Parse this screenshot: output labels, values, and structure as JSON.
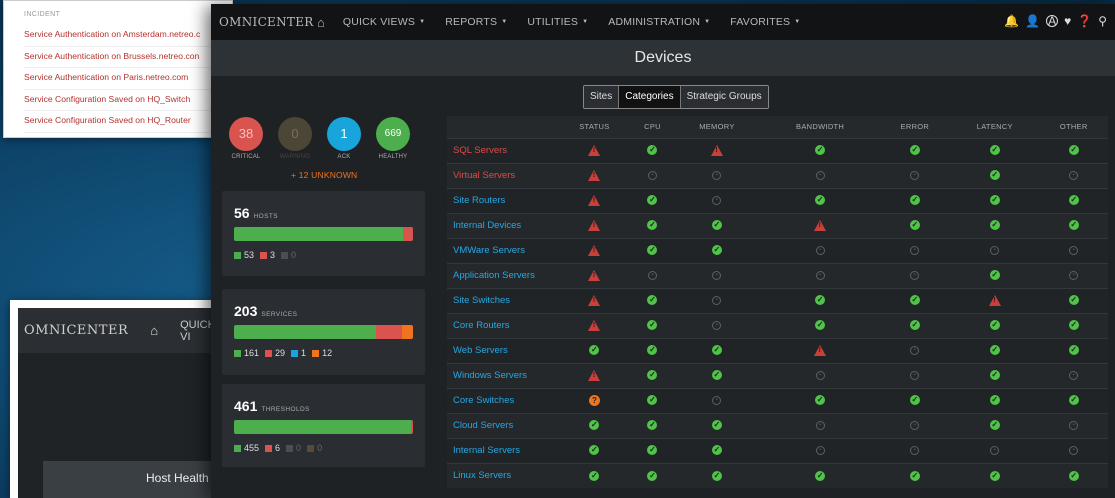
{
  "incident_card": {
    "header": "INCIDENT",
    "rows": [
      "Service Authentication on Amsterdam.netreo.c",
      "Service Authentication on Brussels.netreo.con",
      "Service Authentication on Paris.netreo.com",
      "Service Configuration Saved on HQ_Switch",
      "Service Configuration Saved on HQ_Router"
    ]
  },
  "bg_window": {
    "logo": "OMNICENTER",
    "menu_label": "QUICK VI",
    "host_health": "Host Health"
  },
  "nav": {
    "logo": "OMNICENTER",
    "items": [
      "QUICK VIEWS",
      "REPORTS",
      "UTILITIES",
      "ADMINISTRATION",
      "FAVORITES"
    ]
  },
  "page_title": "Devices",
  "tabs": [
    "Sites",
    "Categories",
    "Strategic Groups"
  ],
  "active_tab": "Categories",
  "stats": [
    {
      "value": "38",
      "label": "CRITICAL"
    },
    {
      "value": "0",
      "label": "WARNING"
    },
    {
      "value": "1",
      "label": "ACK"
    },
    {
      "value": "669",
      "label": "HEALTHY"
    }
  ],
  "unknown_text": "+ 12 UNKNOWN",
  "panels": [
    {
      "count": "56",
      "label": "HOSTS",
      "legend": [
        {
          "value": "53",
          "color": "#4cae4c"
        },
        {
          "value": "3",
          "color": "#d9534f"
        },
        {
          "value": "0",
          "color": "#4a4f54",
          "muted": true
        }
      ],
      "fractions": [
        0.946,
        0.054
      ]
    },
    {
      "count": "203",
      "label": "SERVICES",
      "legend": [
        {
          "value": "161",
          "color": "#4cae4c"
        },
        {
          "value": "29",
          "color": "#d9534f"
        },
        {
          "value": "1",
          "color": "#17a5dc"
        },
        {
          "value": "12",
          "color": "#f0731e"
        }
      ],
      "fractions": [
        0.793,
        0.143,
        0.005,
        0.059
      ]
    },
    {
      "count": "461",
      "label": "THRESHOLDS",
      "legend": [
        {
          "value": "455",
          "color": "#4cae4c"
        },
        {
          "value": "6",
          "color": "#d9534f"
        },
        {
          "value": "0",
          "color": "#4a4f54",
          "muted": true
        },
        {
          "value": "0",
          "color": "#5a4a3a",
          "muted": true
        }
      ],
      "fractions": [
        0.987,
        0.013
      ]
    }
  ],
  "table": {
    "columns": [
      "",
      "STATUS",
      "CPU",
      "MEMORY",
      "BANDWIDTH",
      "ERROR",
      "LATENCY",
      "OTHER"
    ],
    "rows": [
      {
        "name": "SQL Servers",
        "color": "red",
        "cells": [
          "warn",
          "ok",
          "warn",
          "ok",
          "ok",
          "ok",
          "ok"
        ]
      },
      {
        "name": "Virtual Servers",
        "color": "red",
        "cells": [
          "warn",
          "na",
          "na",
          "na",
          "na",
          "ok",
          "na"
        ]
      },
      {
        "name": "Site Routers",
        "color": "blue",
        "cells": [
          "warn",
          "ok",
          "na",
          "ok",
          "ok",
          "ok",
          "ok"
        ]
      },
      {
        "name": "Internal Devices",
        "color": "blue",
        "cells": [
          "warn",
          "ok",
          "ok",
          "warn",
          "ok",
          "ok",
          "ok"
        ]
      },
      {
        "name": "VMWare Servers",
        "color": "blue",
        "cells": [
          "warn",
          "ok",
          "ok",
          "na",
          "na",
          "na",
          "na"
        ]
      },
      {
        "name": "Application Servers",
        "color": "blue",
        "cells": [
          "warn",
          "na",
          "na",
          "na",
          "na",
          "ok",
          "na"
        ]
      },
      {
        "name": "Site Switches",
        "color": "blue",
        "cells": [
          "warn",
          "ok",
          "na",
          "ok",
          "ok",
          "warn",
          "ok"
        ]
      },
      {
        "name": "Core Routers",
        "color": "blue",
        "cells": [
          "warn",
          "ok",
          "na",
          "ok",
          "ok",
          "ok",
          "ok"
        ]
      },
      {
        "name": "Web Servers",
        "color": "blue",
        "cells": [
          "ok",
          "ok",
          "ok",
          "warn",
          "na",
          "ok",
          "ok"
        ]
      },
      {
        "name": "Windows Servers",
        "color": "blue",
        "cells": [
          "warn",
          "ok",
          "ok",
          "na",
          "na",
          "ok",
          "na"
        ]
      },
      {
        "name": "Core Switches",
        "color": "blue",
        "cells": [
          "unk",
          "ok",
          "na",
          "ok",
          "ok",
          "ok",
          "ok"
        ]
      },
      {
        "name": "Cloud Servers",
        "color": "blue",
        "cells": [
          "ok",
          "ok",
          "ok",
          "na",
          "na",
          "ok",
          "na"
        ]
      },
      {
        "name": "Internal Servers",
        "color": "blue",
        "cells": [
          "ok",
          "ok",
          "ok",
          "na",
          "na",
          "na",
          "na"
        ]
      },
      {
        "name": "Linux Servers",
        "color": "blue",
        "cells": [
          "ok",
          "ok",
          "ok",
          "ok",
          "ok",
          "ok",
          "ok"
        ]
      }
    ]
  }
}
